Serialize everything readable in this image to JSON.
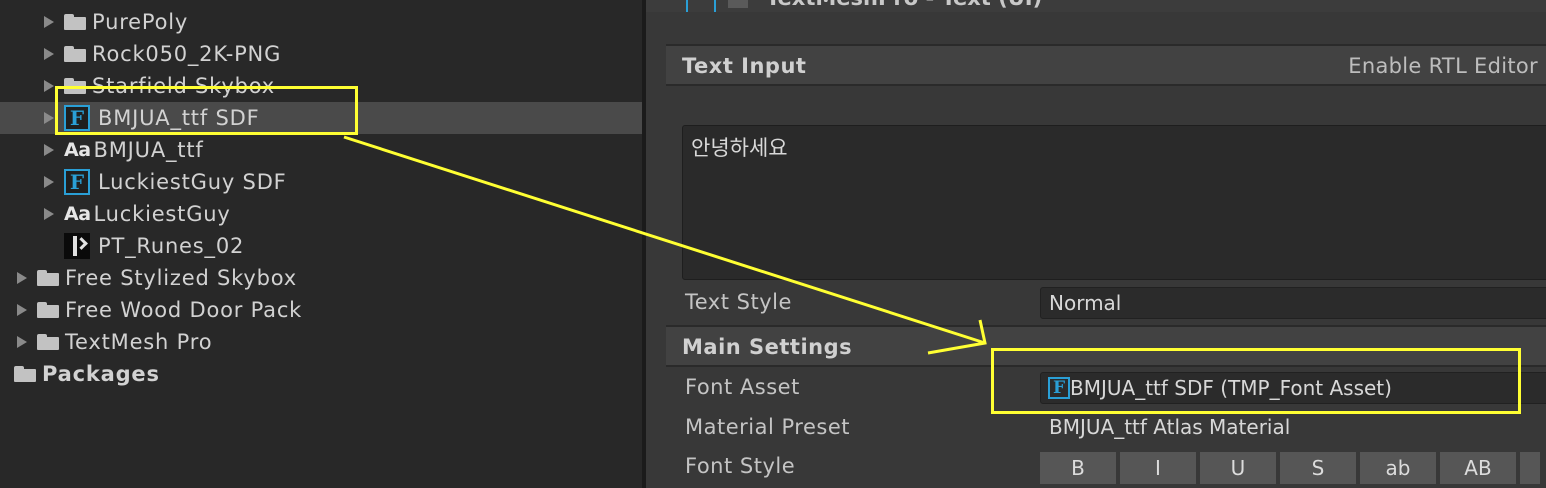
{
  "project_tree": {
    "items": [
      {
        "label": "PurePoly",
        "icon": "folder-icon"
      },
      {
        "label": "Rock050_2K-PNG",
        "icon": "folder-icon"
      },
      {
        "label": "Starfield Skybox",
        "icon": "folder-icon"
      },
      {
        "label": "BMJUA_ttf SDF",
        "icon": "tmp-font-asset-icon"
      },
      {
        "label": "BMJUA_ttf",
        "icon": "font-icon",
        "icon_text": "Aa"
      },
      {
        "label": "LuckiestGuy SDF",
        "icon": "tmp-font-asset-icon"
      },
      {
        "label": "LuckiestGuy",
        "icon": "font-icon",
        "icon_text": "Aa"
      },
      {
        "label": "PT_Runes_02",
        "icon": "texture-icon"
      },
      {
        "label": "Free Stylized Skybox",
        "icon": "folder-icon"
      },
      {
        "label": "Free Wood Door Pack",
        "icon": "folder-icon"
      },
      {
        "label": "TextMesh Pro",
        "icon": "folder-icon"
      },
      {
        "label": "Packages",
        "icon": "folder-icon"
      }
    ]
  },
  "inspector": {
    "component_title": "TextMeshPro - Text (UI)",
    "text_input": {
      "header": "Text Input",
      "rtl_label": "Enable RTL Editor",
      "value": "안녕하세요"
    },
    "text_style": {
      "label": "Text Style",
      "value": "Normal"
    },
    "main_settings": {
      "header": "Main Settings",
      "font_asset": {
        "label": "Font Asset",
        "value": "BMJUA_ttf SDF (TMP_Font Asset)",
        "icon_text": "F"
      },
      "material_preset": {
        "label": "Material Preset",
        "value": "BMJUA_ttf Atlas Material"
      },
      "font_style": {
        "label": "Font Style",
        "buttons": [
          "B",
          "I",
          "U",
          "S",
          "ab",
          "AB"
        ]
      }
    }
  },
  "colors": {
    "tmp_icon_blue": "#2a9fd6",
    "highlight_yellow": "#ffff33",
    "panel_bg": "#282828",
    "inspector_bg": "#383838"
  }
}
